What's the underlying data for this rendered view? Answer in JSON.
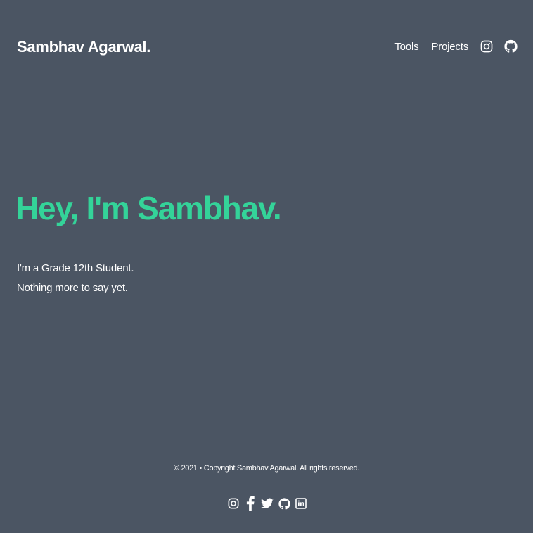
{
  "header": {
    "brand": "Sambhav Agarwal.",
    "nav": {
      "tools": "Tools",
      "projects": "Projects",
      "icons": [
        "instagram-icon",
        "github-icon"
      ]
    }
  },
  "hero": {
    "title": "Hey, I'm Sambhav.",
    "lines": [
      "I'm a Grade 12th Student.",
      "Nothing more to say yet."
    ]
  },
  "footer": {
    "copyright": "© 2021 • Copyright Sambhav Agarwal. All rights reserved.",
    "social_icons": [
      "instagram-icon",
      "facebook-icon",
      "twitter-icon",
      "github-icon",
      "linkedin-icon"
    ]
  },
  "colors": {
    "background": "#4b5563",
    "accent": "#34d399",
    "text": "#ffffff"
  }
}
